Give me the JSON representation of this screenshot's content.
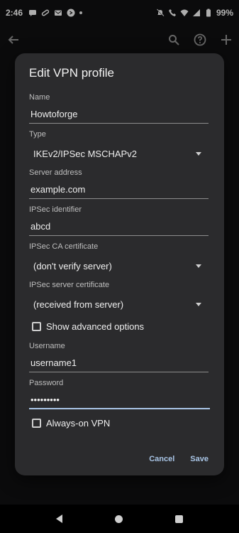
{
  "status_bar": {
    "time": "2:46",
    "battery": "99%",
    "icons": [
      "messaging-icon",
      "link-icon",
      "mail-icon",
      "shazam-icon",
      "notification-dot",
      "mute-icon",
      "wifi-call-icon",
      "wifi-icon",
      "signal-icon",
      "battery-icon"
    ]
  },
  "app_bar": {
    "icons": [
      "back-arrow-icon",
      "search-icon",
      "help-icon",
      "add-icon"
    ]
  },
  "dialog": {
    "title": "Edit VPN profile",
    "fields": {
      "name": {
        "label": "Name",
        "value": "Howtoforge"
      },
      "type": {
        "label": "Type",
        "value": "IKEv2/IPSec MSCHAPv2"
      },
      "server": {
        "label": "Server address",
        "value": "example.com"
      },
      "ipsec_id": {
        "label": "IPSec identifier",
        "value": "abcd"
      },
      "ca_cert": {
        "label": "IPSec CA certificate",
        "value": "(don't verify server)"
      },
      "server_cert": {
        "label": "IPSec server certificate",
        "value": "(received from server)"
      },
      "username": {
        "label": "Username",
        "value": "username1"
      },
      "password": {
        "label": "Password",
        "value": "•••••••••"
      }
    },
    "show_advanced": "Show advanced options",
    "always_on": "Always-on VPN",
    "cancel": "Cancel",
    "save": "Save"
  },
  "colors": {
    "accent": "#a9c5e6",
    "dialog_bg": "#2b2b2d",
    "background": "#0f0f10"
  }
}
